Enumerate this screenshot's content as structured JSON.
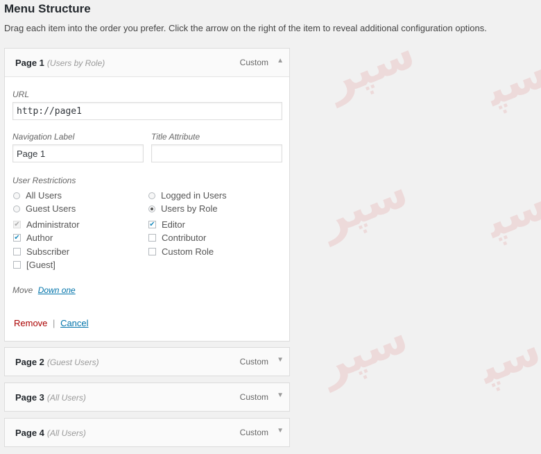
{
  "header": {
    "title": "Menu Structure",
    "description": "Drag each item into the order you prefer. Click the arrow on the right of the item to reveal additional configuration options."
  },
  "menu_items": [
    {
      "title": "Page 1",
      "subtitle": "(Users by Role)",
      "type": "Custom",
      "expanded": true,
      "arrow": "▲"
    },
    {
      "title": "Page 2",
      "subtitle": "(Guest Users)",
      "type": "Custom",
      "expanded": false,
      "arrow": "▼"
    },
    {
      "title": "Page 3",
      "subtitle": "(All Users)",
      "type": "Custom",
      "expanded": false,
      "arrow": "▼"
    },
    {
      "title": "Page 4",
      "subtitle": "(All Users)",
      "type": "Custom",
      "expanded": false,
      "arrow": "▼"
    }
  ],
  "settings": {
    "url_label": "URL",
    "url_value": "http://page1",
    "nav_label": "Navigation Label",
    "nav_value": "Page 1",
    "title_attr_label": "Title Attribute",
    "title_attr_value": "",
    "restrictions_label": "User Restrictions",
    "radios": [
      {
        "label": "All Users",
        "checked": false
      },
      {
        "label": "Logged in Users",
        "checked": false
      },
      {
        "label": "Guest Users",
        "checked": false
      },
      {
        "label": "Users by Role",
        "checked": true
      }
    ],
    "roles": [
      {
        "label": "Administrator",
        "checked": true,
        "disabled": true
      },
      {
        "label": "Editor",
        "checked": true,
        "disabled": false
      },
      {
        "label": "Author",
        "checked": true,
        "disabled": false
      },
      {
        "label": "Contributor",
        "checked": false,
        "disabled": false
      },
      {
        "label": "Subscriber",
        "checked": false,
        "disabled": false
      },
      {
        "label": "Custom Role",
        "checked": false,
        "disabled": false
      },
      {
        "label": "[Guest]",
        "checked": false,
        "disabled": false
      }
    ],
    "move_label": "Move",
    "move_link": "Down one",
    "remove": "Remove",
    "separator": "|",
    "cancel": "Cancel"
  },
  "colors": {
    "accent": "#0073aa",
    "danger": "#aa0000",
    "background": "#f1f1f1"
  }
}
